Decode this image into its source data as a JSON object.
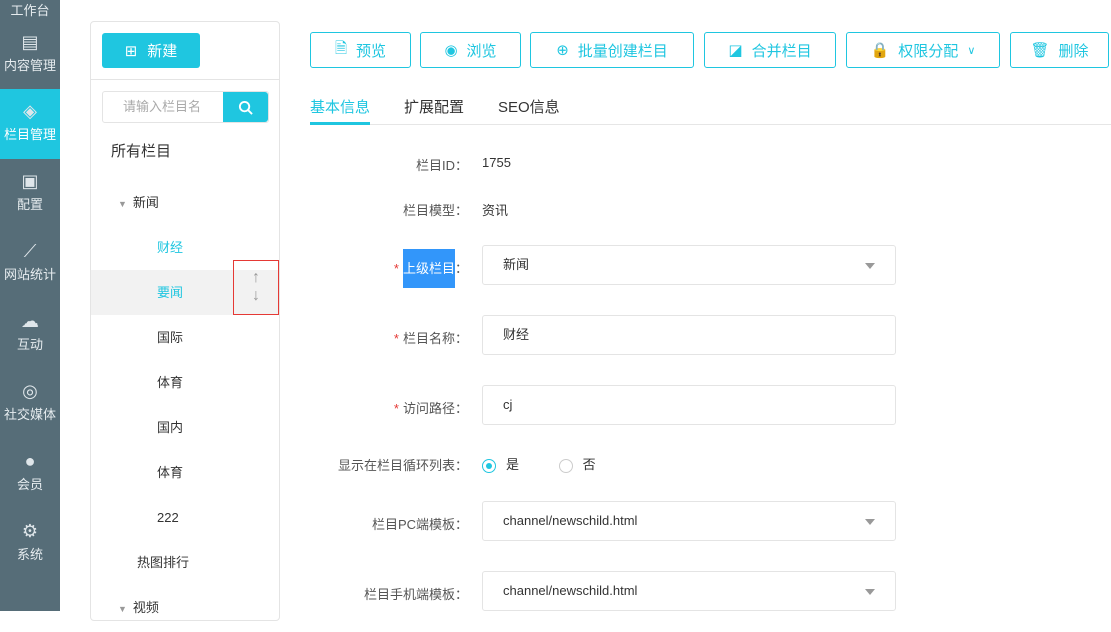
{
  "sidebar": {
    "items": [
      {
        "label": "工作台",
        "icon": "home-icon"
      },
      {
        "label": "内容管理",
        "icon": "document-icon"
      },
      {
        "label": "栏目管理",
        "icon": "layers-icon",
        "active": true
      },
      {
        "label": "配置",
        "icon": "cube-icon"
      },
      {
        "label": "网站统计",
        "icon": "chart-icon"
      },
      {
        "label": "互动",
        "icon": "chat-icon"
      },
      {
        "label": "社交媒体",
        "icon": "target-icon"
      },
      {
        "label": "会员",
        "icon": "user-icon"
      },
      {
        "label": "系统",
        "icon": "gear-icon"
      }
    ]
  },
  "tree": {
    "new_label": "新建",
    "search_placeholder": "请输入栏目名",
    "root": "所有栏目",
    "nodes": [
      {
        "label": "新闻"
      },
      {
        "label": "财经"
      },
      {
        "label": "要闻"
      },
      {
        "label": "国际"
      },
      {
        "label": "体育"
      },
      {
        "label": "国内"
      },
      {
        "label": "体育"
      },
      {
        "label": "222"
      },
      {
        "label": "热图排行"
      },
      {
        "label": "视频"
      }
    ]
  },
  "toolbar": {
    "preview": "预览",
    "browse": "浏览",
    "batch_create": "批量创建栏目",
    "merge": "合并栏目",
    "permissions": "权限分配",
    "delete": "删除"
  },
  "tabs": [
    "基本信息",
    "扩展配置",
    "SEO信息"
  ],
  "form": {
    "id_label": "栏目ID：",
    "id_value": "1755",
    "model_label": "栏目模型：",
    "model_value": "资讯",
    "parent_label": "上级栏目",
    "colon": "：",
    "parent_value": "新闻",
    "name_label": "栏目名称：",
    "name_value": "财经",
    "path_label": "访问路径：",
    "path_value": "cj",
    "loop_label": "显示在栏目循环列表：",
    "yes": "是",
    "no": "否",
    "pc_label": "栏目PC端模板：",
    "pc_value": "channel/newschild.html",
    "mobile_label": "栏目手机端模板：",
    "mobile_value": "channel/newschild.html",
    "required": "*"
  }
}
